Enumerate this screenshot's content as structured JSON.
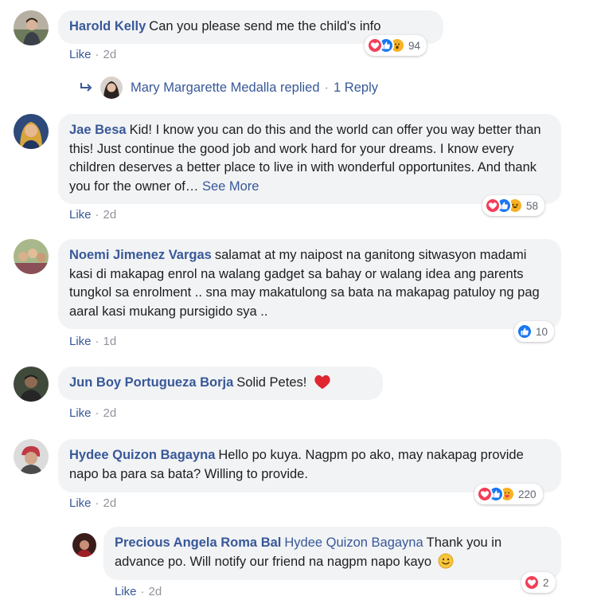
{
  "comments": [
    {
      "author": "Harold Kelly",
      "text": "Can you please send me the child's info",
      "like_label": "Like",
      "time": "2d",
      "reaction_count": "94",
      "reactions": [
        "love-icon",
        "like-icon",
        "wow-icon"
      ]
    },
    {
      "author": "Jae Besa",
      "text": "Kid! I know you can do this and the world can offer you way better than this! Just continue the good job and work hard for your dreams. I know every children deserves a better place to live in with wonderful opportunites. And thank you for the owner of…",
      "see_more": "See More",
      "like_label": "Like",
      "time": "2d",
      "reaction_count": "58",
      "reactions": [
        "love-icon",
        "like-icon",
        "haha-icon"
      ]
    },
    {
      "author": "Noemi Jimenez Vargas",
      "text": "salamat at my naipost na ganitong sitwasyon madami kasi di makapag enrol na walang gadget sa bahay or walang idea ang parents tungkol sa enrolment .. sna may makatulong sa bata na makapag patuloy ng pag aaral kasi mukang pursigido sya ..",
      "like_label": "Like",
      "time": "1d",
      "reaction_count": "10",
      "reactions": [
        "like-icon"
      ]
    },
    {
      "author": "Jun Boy Portugueza Borja",
      "text": "Solid Petes!",
      "like_label": "Like",
      "time": "2d"
    },
    {
      "author": "Hydee Quizon Bagayna",
      "text": "Hello po kuya. Nagpm po ako, may nakapag provide napo ba para sa bata? Willing to provide.",
      "like_label": "Like",
      "time": "2d",
      "reaction_count": "220",
      "reactions": [
        "love-icon",
        "like-icon",
        "care-icon"
      ]
    }
  ],
  "reply_summary": {
    "name": "Mary Margarette Medalla",
    "action": "replied",
    "count": "1 Reply"
  },
  "reply": {
    "author": "Precious Angela Roma Bal",
    "mention": "Hydee Quizon Bagayna",
    "text": "Thank you in advance po. Will notify our friend na nagpm napo kayo",
    "like_label": "Like",
    "time": "2d",
    "reaction_count": "2",
    "reactions": [
      "love-icon"
    ]
  },
  "colors": {
    "link": "#385898",
    "bubble": "#f2f3f5",
    "like": "#1877f2",
    "love": "#f33e58",
    "wow": "#f7b125"
  }
}
